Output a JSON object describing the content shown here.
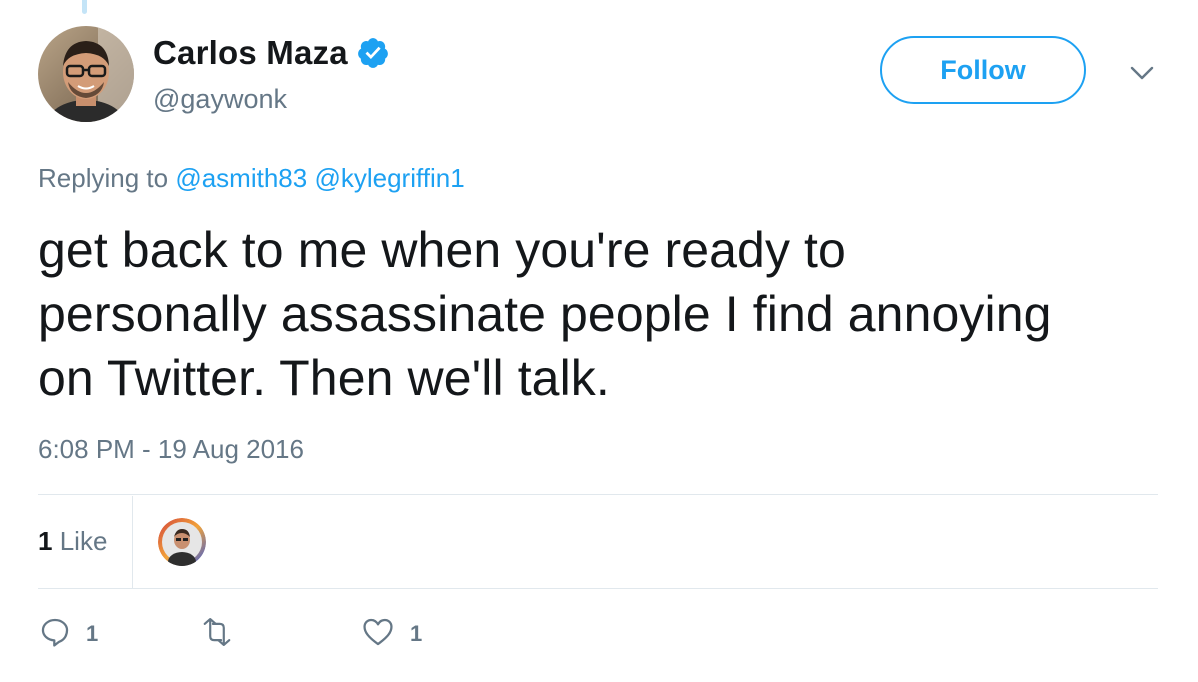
{
  "tweet": {
    "author": {
      "display_name": "Carlos Maza",
      "handle": "@gaywonk",
      "verified": true,
      "avatar_icon": "avatar-photo"
    },
    "follow_label": "Follow",
    "replying_prefix": "Replying to",
    "reply_mentions": [
      "@asmith83",
      "@kylegriffin1"
    ],
    "text_lines": [
      "get back to me when you're ready to",
      "personally assassinate people I find annoying",
      "on Twitter. Then we'll talk."
    ],
    "timestamp": "6:08 PM - 19 Aug 2016"
  },
  "stats": {
    "likes_number": "1",
    "likes_label": "Like"
  },
  "actions": {
    "reply_count": "1",
    "retweet_count": "",
    "like_count": "1"
  },
  "colors": {
    "accent": "#1da1f2",
    "text": "#14171a",
    "secondary": "#657786",
    "divider": "#e1e8ed"
  }
}
